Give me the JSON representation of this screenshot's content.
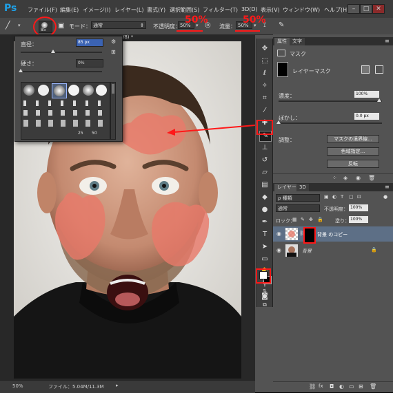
{
  "app": {
    "logo": "Ps"
  },
  "menu": [
    "ファイル(F)",
    "編集(E)",
    "イメージ(I)",
    "レイヤー(L)",
    "書式(Y)",
    "選択範囲(S)",
    "フィルター(T)",
    "3D(D)",
    "表示(V)",
    "ウィンドウ(W)",
    "ヘルプ(H)"
  ],
  "window_buttons": {
    "minimize": "–",
    "maximize": "□",
    "close": "✕"
  },
  "options": {
    "brush_size": "85",
    "mode_label": "モード：",
    "mode_value": "通常",
    "opacity_label": "不透明度：",
    "opacity_value": "50%",
    "flow_label": "流量：",
    "flow_value": "50%"
  },
  "annotations": {
    "opacity_callout": "50%",
    "flow_callout": "50%",
    "white_label": "白"
  },
  "document": {
    "tab_label": "/8) *",
    "zoom": "50%",
    "file_info": "ファイル：5.04M/11.3M"
  },
  "brush_popup": {
    "size_label": "直径：",
    "size_value": "85 px",
    "hardness_label": "硬さ：",
    "hardness_value": "0%",
    "preset_sizes": [
      "25",
      "50"
    ],
    "size_fraction": 0.4,
    "hardness_fraction": 0.0
  },
  "properties_panel": {
    "tabs": [
      "属性",
      "文字"
    ],
    "mask_title": "マスク",
    "layer_mask_label": "レイヤーマスク",
    "density_label": "濃度：",
    "density_value": "100%",
    "feather_label": "ぼかし：",
    "feather_value": "0.0 px",
    "adjust_label": "調整：",
    "buttons": [
      "マスクの境界線...",
      "色域指定...",
      "反転"
    ]
  },
  "layers_panel": {
    "tabs": [
      "レイヤー",
      "3D"
    ],
    "filter_value": "ρ 種類",
    "blend_value": "通常",
    "opacity_label": "不透明度：",
    "opacity_value": "100%",
    "lock_label": "ロック：",
    "fill_label": "塗り：",
    "fill_value": "100%",
    "layers": [
      {
        "name": "背景 のコピー",
        "selected": true,
        "has_mask": true
      },
      {
        "name": "背景",
        "selected": false,
        "has_mask": false,
        "locked": true
      }
    ]
  },
  "colors": {
    "overlay": "#e87a6a",
    "annotation": "#ff1818",
    "selected_layer": "#5d6f86"
  }
}
